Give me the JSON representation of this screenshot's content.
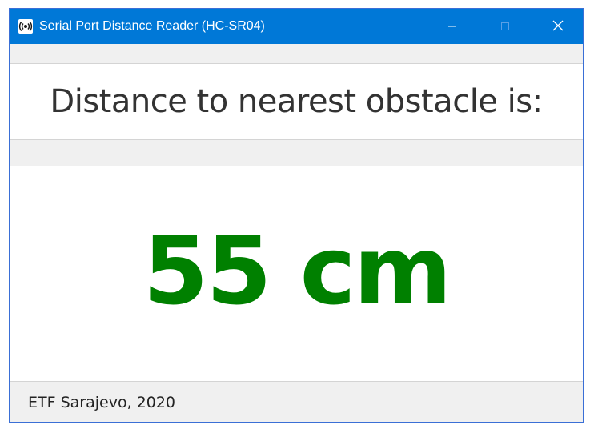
{
  "window": {
    "title": "Serial Port Distance Reader (HC-SR04)",
    "app_icon": "radio-signal-icon",
    "controls": {
      "minimize_icon": "minimize-icon",
      "maximize_icon": "maximize-icon",
      "close_icon": "close-icon"
    },
    "titlebar_color": "#0078d7"
  },
  "header": {
    "label": "Distance to nearest obstacle is:"
  },
  "reading": {
    "value": "55 cm",
    "color": "#008000"
  },
  "footer": {
    "text": "ETF Sarajevo, 2020"
  }
}
